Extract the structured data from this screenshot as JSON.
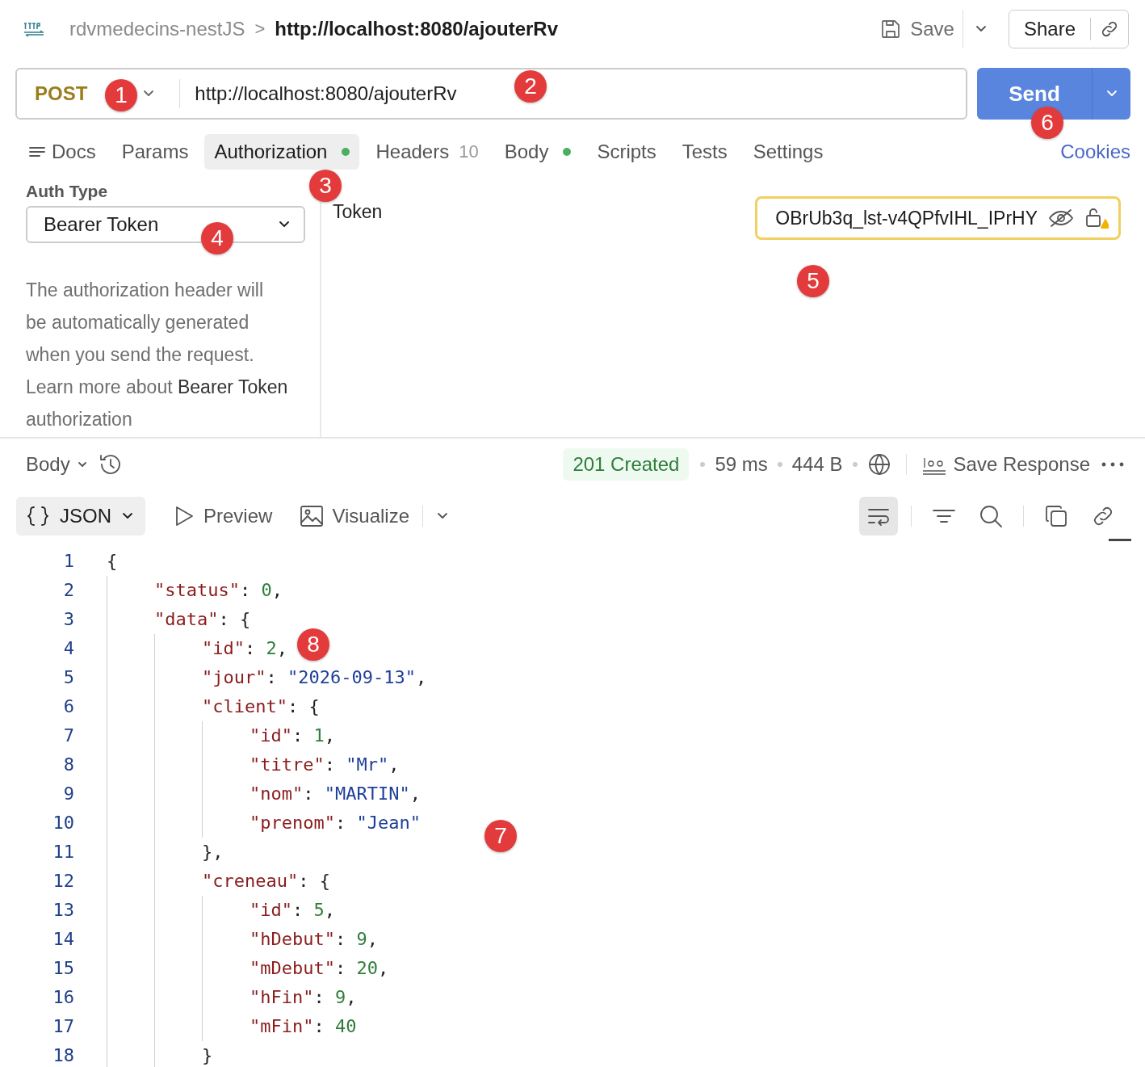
{
  "breadcrumb": {
    "collection": "rdvmedecins-nestJS",
    "separator": ">",
    "request": "http://localhost:8080/ajouterRv"
  },
  "header_actions": {
    "save": "Save",
    "share": "Share"
  },
  "request": {
    "method": "POST",
    "url": "http://localhost:8080/ajouterRv",
    "send": "Send"
  },
  "tabs": [
    {
      "label": "Docs",
      "selected": false,
      "dot": false
    },
    {
      "label": "Params",
      "selected": false,
      "dot": false
    },
    {
      "label": "Authorization",
      "selected": true,
      "dot": true
    },
    {
      "label": "Headers",
      "count": "10",
      "selected": false,
      "dot": false
    },
    {
      "label": "Body",
      "selected": false,
      "dot": true
    },
    {
      "label": "Scripts",
      "selected": false,
      "dot": false
    },
    {
      "label": "Tests",
      "selected": false,
      "dot": false
    },
    {
      "label": "Settings",
      "selected": false,
      "dot": false
    }
  ],
  "cookies": "Cookies",
  "auth": {
    "type_label": "Auth Type",
    "type": "Bearer Token",
    "description": "The authorization header will be automatically generated when you send the request. Learn more about",
    "link": "Bearer Token",
    "after_link": "authorization",
    "token_label": "Token",
    "token": "OBrUb3q_lst-v4QPfvIHL_IPrHY"
  },
  "response": {
    "body_menu": "Body",
    "status": "201 Created",
    "time": "59 ms",
    "size": "444 B",
    "save_response": "Save Response",
    "format": "JSON",
    "preview": "Preview",
    "visualize": "Visualize",
    "wrap_on": true
  },
  "code_lines": [
    {
      "number": "1",
      "text": "{"
    },
    {
      "number": "2",
      "text": "    \"status\": 0,"
    },
    {
      "number": "3",
      "text": "    \"data\": {"
    },
    {
      "number": "4",
      "text": "        \"id\": 2,"
    },
    {
      "number": "5",
      "text": "        \"jour\": \"2026-09-13\","
    },
    {
      "number": "6",
      "text": "        \"client\": {"
    },
    {
      "number": "7",
      "text": "            \"id\": 1,"
    },
    {
      "number": "8",
      "text": "            \"titre\": \"Mr\","
    },
    {
      "number": "9",
      "text": "            \"nom\": \"MARTIN\","
    },
    {
      "number": "10",
      "text": "            \"prenom\": \"Jean\""
    },
    {
      "number": "11",
      "text": "        },"
    },
    {
      "number": "12",
      "text": "        \"creneau\": {"
    },
    {
      "number": "13",
      "text": "            \"id\": 5,"
    },
    {
      "number": "14",
      "text": "            \"hDebut\": 9,"
    },
    {
      "number": "15",
      "text": "            \"mDebut\": 20,"
    },
    {
      "number": "16",
      "text": "            \"hFin\": 9,"
    },
    {
      "number": "17",
      "text": "            \"mFin\": 40"
    },
    {
      "number": "18",
      "text": "        }"
    }
  ],
  "callouts": [
    {
      "number": "1"
    },
    {
      "number": "2"
    },
    {
      "number": "3"
    },
    {
      "number": "4"
    },
    {
      "number": "5"
    },
    {
      "number": "6"
    },
    {
      "number": "7"
    },
    {
      "number": "8"
    }
  ]
}
